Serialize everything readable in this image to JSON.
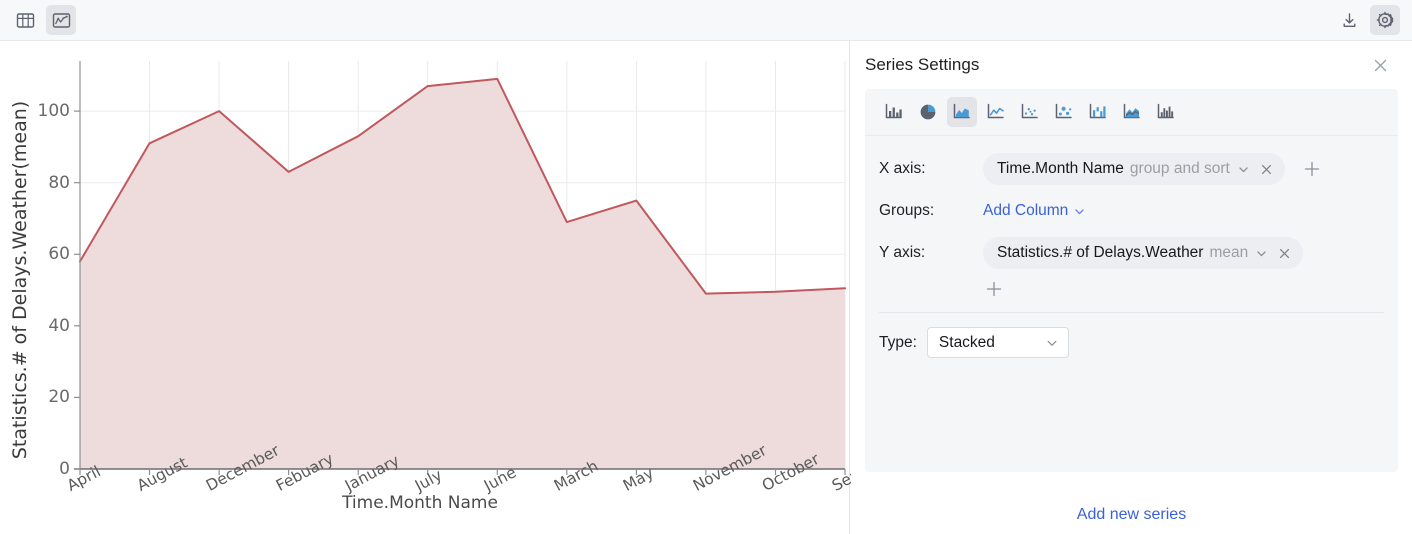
{
  "toolbar": {
    "left_buttons": [
      {
        "name": "table-view",
        "icon": "table-icon",
        "selected": false
      },
      {
        "name": "chart-view",
        "icon": "line-chart-icon",
        "selected": true
      }
    ],
    "right_buttons": [
      {
        "name": "export",
        "icon": "download-icon",
        "selected": false
      },
      {
        "name": "settings",
        "icon": "gear-icon",
        "selected": true
      }
    ]
  },
  "panel": {
    "title": "Series Settings",
    "close_icon": "close-icon",
    "chart_types": [
      {
        "label": "Bar",
        "icon": "bar-chart-icon",
        "selected": false
      },
      {
        "label": "Pie",
        "icon": "pie-chart-icon",
        "selected": false
      },
      {
        "label": "Area",
        "icon": "area-chart-icon",
        "selected": true
      },
      {
        "label": "Line",
        "icon": "line-chart-icon",
        "selected": false
      },
      {
        "label": "Scatter",
        "icon": "scatter-chart-icon",
        "selected": false
      },
      {
        "label": "Bubble",
        "icon": "bubble-chart-icon",
        "selected": false
      },
      {
        "label": "Range",
        "icon": "range-chart-icon",
        "selected": false
      },
      {
        "label": "Area Line",
        "icon": "area-line-chart-icon",
        "selected": false
      },
      {
        "label": "Histogram",
        "icon": "histogram-chart-icon",
        "selected": false
      }
    ],
    "x_axis": {
      "label": "X axis:",
      "field": "Time.Month Name",
      "modifier": "group and sort",
      "chevron_icon": "chevron-down-icon",
      "remove_icon": "close-icon",
      "add_icon": "plus-icon"
    },
    "groups": {
      "label": "Groups:",
      "add_label": "Add Column",
      "chevron_icon": "chevron-down-icon"
    },
    "y_axis": {
      "label": "Y axis:",
      "field": "Statistics.# of Delays.Weather",
      "modifier": "mean",
      "chevron_icon": "chevron-down-icon",
      "remove_icon": "close-icon",
      "add_icon": "plus-icon"
    },
    "type": {
      "label": "Type:",
      "value": "Stacked",
      "chevron_icon": "chevron-down-icon"
    },
    "add_new_series": "Add new series",
    "accent_color": "#3a62d8",
    "card_bg": "#f5f6f8"
  },
  "chart_data": {
    "type": "area",
    "title": "",
    "xlabel": "Time.Month Name",
    "ylabel": "Statistics.# of Delays.Weather(mean)",
    "categories": [
      "April",
      "August",
      "December",
      "Febuary",
      "January",
      "July",
      "June",
      "March",
      "May",
      "November",
      "October",
      "September"
    ],
    "values": [
      58,
      91,
      100,
      83,
      93,
      107,
      109,
      69,
      75,
      49,
      49.5,
      50.5
    ],
    "series": [
      {
        "name": "Statistics.# of Delays.Weather(mean)",
        "values": [
          58,
          91,
          100,
          83,
          93,
          107,
          109,
          69,
          75,
          49,
          49.5,
          50.5
        ]
      }
    ],
    "yticks": [
      0,
      20,
      40,
      60,
      80,
      100
    ],
    "ylim": [
      0,
      114
    ],
    "grid": true,
    "legend": "none",
    "line_color": "#c0585e",
    "fill_color": "#eedcdd"
  }
}
